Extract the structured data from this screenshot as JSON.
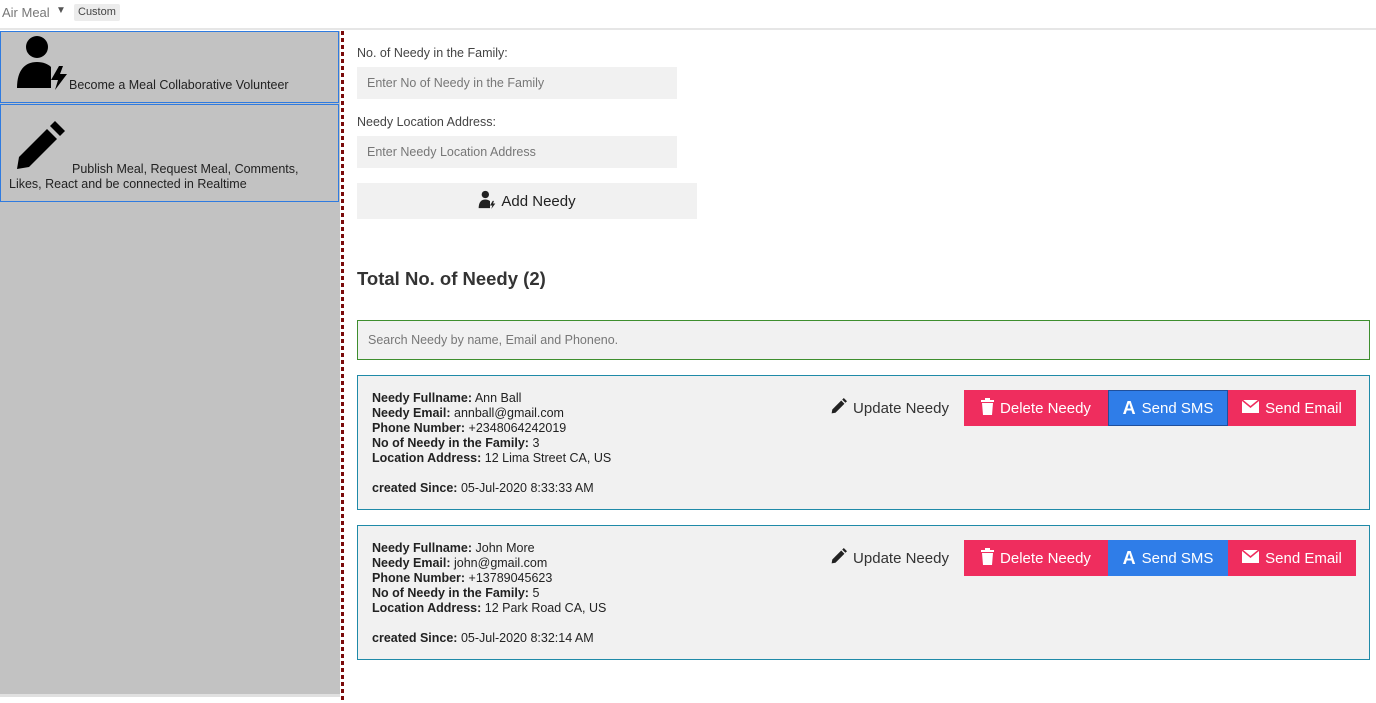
{
  "topbar": {
    "app_title": "Air Meal",
    "badge": "Custom"
  },
  "sidebar": {
    "items": [
      {
        "label": "Become a Meal Collaborative Volunteer",
        "icon": "user-bolt-icon"
      },
      {
        "label": "Publish Meal, Request Meal, Comments, Likes, React and be connected in Realtime",
        "icon": "pencil-icon"
      }
    ]
  },
  "form": {
    "family_label": "No. of Needy in the Family:",
    "family_placeholder": "Enter No of Needy in the Family",
    "address_label": "Needy Location Address:",
    "address_placeholder": "Enter Needy Location Address",
    "add_button": "Add Needy"
  },
  "list": {
    "total_title": "Total No. of Needy (2)",
    "search_placeholder": "Search Needy by name, Email and Phoneno."
  },
  "field_labels": {
    "fullname": "Needy Fullname:",
    "email": "Needy Email:",
    "phone": "Phone Number:",
    "family": "No of Needy in the Family:",
    "address": "Location Address:",
    "since": "created Since:"
  },
  "buttons": {
    "update": "Update Needy",
    "delete": "Delete Needy",
    "sms": "Send SMS",
    "email": "Send Email"
  },
  "needy": [
    {
      "fullname": "Ann Ball",
      "email": "annball@gmail.com",
      "phone": "+2348064242019",
      "family": "3",
      "address": "12 Lima Street CA, US",
      "since": "05-Jul-2020 8:33:33 AM"
    },
    {
      "fullname": "John More",
      "email": "john@gmail.com",
      "phone": "+13789045623",
      "family": "5",
      "address": "12 Park Road CA, US",
      "since": "05-Jul-2020 8:32:14 AM"
    }
  ],
  "colors": {
    "accent_blue": "#2f7de8",
    "danger_red": "#ef2d5e",
    "sidebar_bg": "#c2c2c2",
    "card_border": "#1f8aa8",
    "search_border": "#3e8e2e"
  }
}
